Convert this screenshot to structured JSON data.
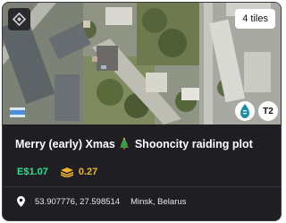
{
  "card": {
    "tiles_badge": "4 tiles",
    "tier_badge": "T2",
    "title": "Merry (early) Xmas",
    "title_suffix": "Shooncity raiding plot",
    "price": "E$1.07",
    "stake_value": "0.27",
    "coordinates": "53.907776, 27.598514",
    "city": "Minsk, Belarus"
  },
  "colors": {
    "price": "#2ee08f",
    "stake": "#f0b429",
    "card_bg": "#1f1f23"
  },
  "icons": [
    "logo-icon",
    "flag-icon",
    "e-crest-icon",
    "christmas-tree-icon",
    "stake-stack-icon",
    "location-pin-icon"
  ]
}
